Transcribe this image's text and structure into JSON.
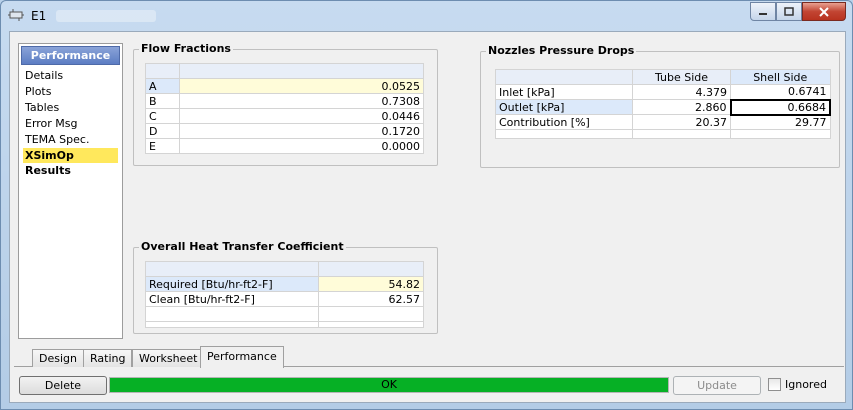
{
  "window": {
    "title": "E1"
  },
  "sidebar": {
    "header": "Performance",
    "items": [
      {
        "label": "Details"
      },
      {
        "label": "Plots"
      },
      {
        "label": "Tables"
      },
      {
        "label": "Error Msg"
      },
      {
        "label": "TEMA Spec."
      },
      {
        "label": "XSimOp Results"
      }
    ],
    "selected": "XSimOp Results"
  },
  "flow_fractions": {
    "title": "Flow Fractions",
    "rows": [
      {
        "label": "A",
        "value": "0.0525"
      },
      {
        "label": "B",
        "value": "0.7308"
      },
      {
        "label": "C",
        "value": "0.0446"
      },
      {
        "label": "D",
        "value": "0.1720"
      },
      {
        "label": "E",
        "value": "0.0000"
      }
    ]
  },
  "nozzles": {
    "title": "Nozzles Pressure Drops",
    "columns": [
      "Tube Side",
      "Shell Side"
    ],
    "rows": [
      {
        "label": "Inlet [kPa]",
        "tube": "4.379",
        "shell": "0.6741"
      },
      {
        "label": "Outlet [kPa]",
        "tube": "2.860",
        "shell": "0.6684"
      },
      {
        "label": "Contribution [%]",
        "tube": "20.37",
        "shell": "29.77"
      }
    ]
  },
  "heat_transfer": {
    "title": "Overall Heat Transfer Coefficient",
    "rows": [
      {
        "label": "Required [Btu/hr-ft2-F]",
        "value": "54.82"
      },
      {
        "label": "Clean [Btu/hr-ft2-F]",
        "value": "62.57"
      }
    ]
  },
  "tabs": [
    {
      "label": "Design"
    },
    {
      "label": "Rating"
    },
    {
      "label": "Worksheet"
    },
    {
      "label": "Performance"
    }
  ],
  "active_tab": "Performance",
  "footer": {
    "delete_label": "Delete",
    "status_text": "OK",
    "status_color": "#06b025",
    "update_label": "Update",
    "ignored_label": "Ignored",
    "ignored_checked": false
  }
}
